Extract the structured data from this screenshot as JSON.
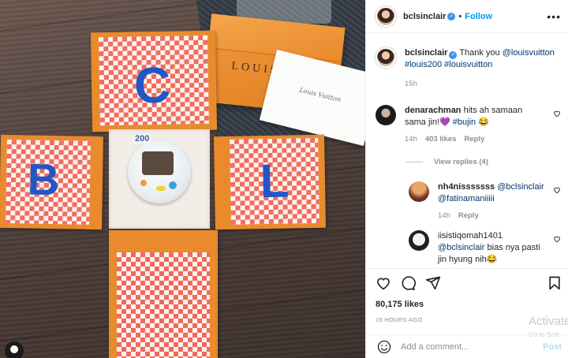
{
  "post": {
    "username": "bclsinclair",
    "verified_icon": "verified-badge-icon",
    "follow_label": "Follow",
    "dot": "•",
    "more_label": "•••"
  },
  "photo": {
    "brand_text": "LOUIS",
    "card_script": "Louis Vuitton",
    "letters": [
      "C",
      "B",
      "L"
    ],
    "cake_number": "200",
    "colors": {
      "box_orange": "#e98a2d",
      "check_red": "#f06a5b",
      "letter_blue": "#1f57c6"
    }
  },
  "caption": {
    "username": "bclsinclair",
    "text": "Thank you ",
    "mention": "@louisvuitton",
    "hashtags": "#louis200 #louisvuitton",
    "time": "15h"
  },
  "comments": [
    {
      "username": "denarachman",
      "text_a": "hits ah samaan sama jin!",
      "emoji_a": "💜",
      "hashtag": "#bujin",
      "emoji_b": "😂",
      "time": "14h",
      "likes": "403 likes",
      "reply": "Reply"
    }
  ],
  "view_replies": "View replies (4)",
  "replies": [
    {
      "username": "nh4nisssssss",
      "mention_a": "@bclsinclair",
      "mention_b": "@fatinamaniiiii",
      "time": "14h",
      "reply": "Reply"
    },
    {
      "username": "iisistiqomah1401",
      "mention": "@bclsinclair",
      "text": " bias nya pasti jin hyung nih",
      "emoji": "😂"
    }
  ],
  "actions": {
    "like_icon": "heart-outline-icon",
    "comment_icon": "comment-bubble-icon",
    "share_icon": "paper-plane-icon",
    "save_icon": "bookmark-icon"
  },
  "likes": "80,175 likes",
  "timestamp": "15 HOURS AGO",
  "watermark": {
    "title": "Activate",
    "subtitle": "Go to Sett"
  },
  "add_comment": {
    "placeholder": "Add a comment...",
    "post_label": "Post"
  }
}
